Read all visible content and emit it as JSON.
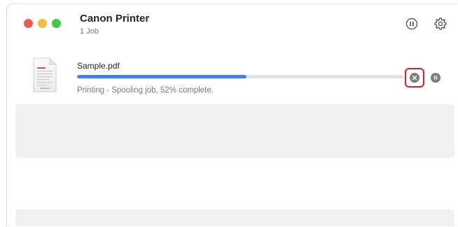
{
  "window": {
    "title": "Canon Printer",
    "subtitle": "1 Job"
  },
  "toolbar": {
    "pause_icon": "pause-circle-icon",
    "settings_icon": "gear-icon"
  },
  "job": {
    "file_name": "Sample.pdf",
    "file_icon": "pdf-document-icon",
    "status": "Printing - Spooling job, 52% complete.",
    "progress": 0.52,
    "cancel_icon": "cancel-circle-icon",
    "pause_icon": "pause-circle-icon"
  },
  "colors": {
    "progress_fill": "#3b82f6",
    "progress_track": "#e3e3e3",
    "highlight": "#e02020",
    "close": "#ee5b55",
    "minimize": "#f6bd3b",
    "maximize": "#3fc84b"
  }
}
